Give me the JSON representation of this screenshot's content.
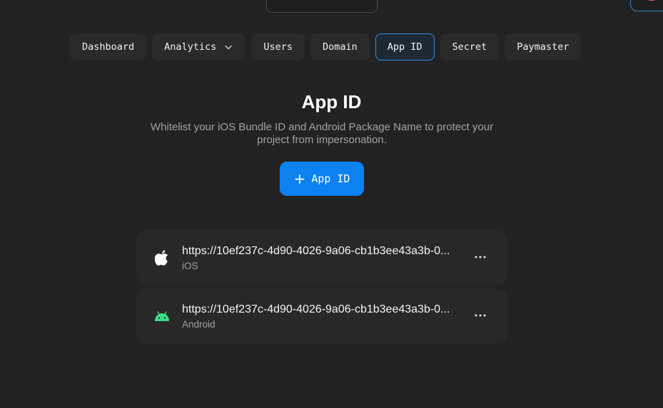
{
  "tabs": [
    {
      "label": "Dashboard",
      "active": false
    },
    {
      "label": "Analytics",
      "active": false,
      "dropdown": true
    },
    {
      "label": "Users",
      "active": false
    },
    {
      "label": "Domain",
      "active": false
    },
    {
      "label": "App ID",
      "active": true
    },
    {
      "label": "Secret",
      "active": false
    },
    {
      "label": "Paymaster",
      "active": false
    }
  ],
  "header": {
    "title": "App ID",
    "subtitle": "Whitelist your iOS Bundle ID and Android Package Name to protect your project from impersonation."
  },
  "add_button": {
    "icon": "plus-icon",
    "label": "App ID"
  },
  "app_ids": [
    {
      "icon": "apple-icon",
      "url": "https://10ef237c-4d90-4026-9a06-cb1b3ee43a3b-0...",
      "platform": "iOS"
    },
    {
      "icon": "android-icon",
      "url": "https://10ef237c-4d90-4026-9a06-cb1b3ee43a3b-0...",
      "platform": "Android"
    }
  ],
  "colors": {
    "background": "#222222",
    "accent": "#0b82f0",
    "active_tab_border": "#2f8fe6",
    "android_green": "#3ddc84"
  }
}
